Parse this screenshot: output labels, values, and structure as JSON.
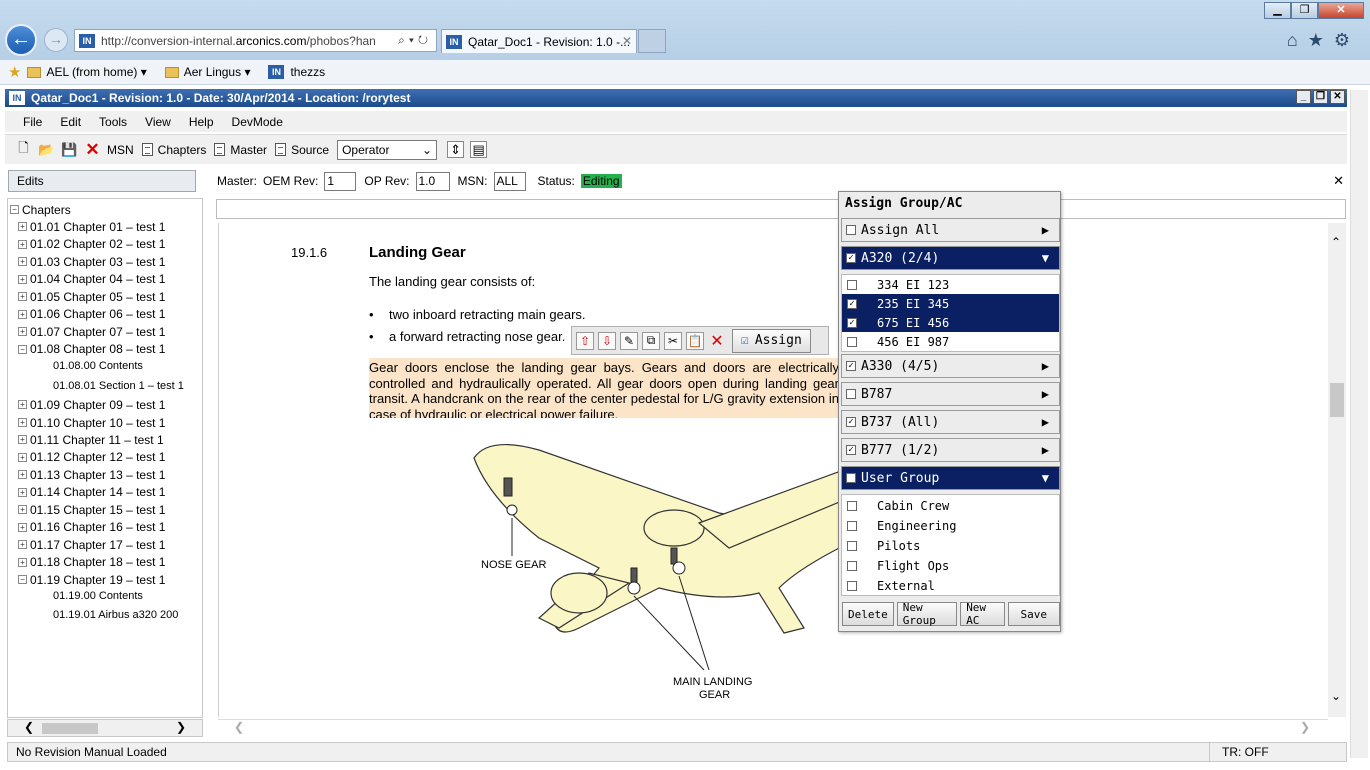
{
  "browser": {
    "url_prefix": "http://conversion-internal.",
    "url_domain": "arconics.com",
    "url_suffix": "/phobos?han",
    "tab_title": "Qatar_Doc1 - Revision: 1.0 -...",
    "favorites": [
      "AEL (from home) ▾",
      "Aer Lingus ▾",
      "thezzs"
    ]
  },
  "app": {
    "title": "Qatar_Doc1 - Revision: 1.0 - Date: 30/Apr/2014 - Location: /rorytest",
    "menu": [
      "File",
      "Edit",
      "Tools",
      "View",
      "Help",
      "DevMode"
    ],
    "toolbar": {
      "msn": "MSN",
      "chapters": "Chapters",
      "master": "Master",
      "source": "Source",
      "view_select": "Operator"
    },
    "edits_tab": "Edits",
    "master_bar": {
      "master_label": "Master:",
      "oem_rev_label": "OEM Rev:",
      "oem_rev_value": "1",
      "op_rev_label": "OP Rev:",
      "op_rev_value": "1.0",
      "msn_label": "MSN:",
      "msn_value": "ALL",
      "status_label": "Status:",
      "status_value": "Editing"
    },
    "status_bar": {
      "left": "No Revision Manual Loaded",
      "right": "TR: OFF"
    }
  },
  "tree": {
    "root": "Chapters",
    "items": [
      {
        "label": "01.01 Chapter 01 – test 1",
        "expanded": false
      },
      {
        "label": "01.02 Chapter 02 – test 1",
        "expanded": false
      },
      {
        "label": "01.03 Chapter 03 – test 1",
        "expanded": false
      },
      {
        "label": "01.04 Chapter 04 – test 1",
        "expanded": false
      },
      {
        "label": "01.05 Chapter 05 – test 1",
        "expanded": false
      },
      {
        "label": "01.06 Chapter 06 – test 1",
        "expanded": false
      },
      {
        "label": "01.07 Chapter 07 – test 1",
        "expanded": false
      },
      {
        "label": "01.08 Chapter 08 – test 1",
        "expanded": true
      },
      {
        "label": "01.08.00 Contents",
        "leaf": true
      },
      {
        "label": "01.08.01 Section 1 – test 1",
        "leaf": true
      },
      {
        "label": "01.09 Chapter 09 – test 1",
        "expanded": false
      },
      {
        "label": "01.10 Chapter 10 – test 1",
        "expanded": false
      },
      {
        "label": "01.11 Chapter 11 – test 1",
        "expanded": false
      },
      {
        "label": "01.12 Chapter 12 – test 1",
        "expanded": false
      },
      {
        "label": "01.13 Chapter 13 – test 1",
        "expanded": false
      },
      {
        "label": "01.14 Chapter 14 – test 1",
        "expanded": false
      },
      {
        "label": "01.15 Chapter 15 – test 1",
        "expanded": false
      },
      {
        "label": "01.16 Chapter 16 – test 1",
        "expanded": false
      },
      {
        "label": "01.17 Chapter 17 – test 1",
        "expanded": false
      },
      {
        "label": "01.18 Chapter 18 – test 1",
        "expanded": false
      },
      {
        "label": "01.19 Chapter 19 – test 1",
        "expanded": true
      },
      {
        "label": "01.19.00 Contents",
        "leaf": true
      },
      {
        "label": "01.19.01 Airbus a320 200",
        "leaf": true
      }
    ]
  },
  "document": {
    "section_number": "19.1.6",
    "section_title": "Landing Gear",
    "intro": "The landing gear consists of:",
    "bullets": [
      "two inboard retracting main gears.",
      "a forward retracting nose gear."
    ],
    "highlight_text": "Gear doors enclose the landing gear bays. Gears and doors are electrically controlled and hydraulically operated. All gear doors open during landing gear transit. A handcrank on the rear of the center pedestal for L/G gravity extension in case of hydraulic or electrical power failure.",
    "figure_labels": {
      "nose_gear": "NOSE GEAR",
      "main_gear_line1": "MAIN LANDING",
      "main_gear_line2": "GEAR"
    },
    "assign_button": "Assign"
  },
  "assign_panel": {
    "title": "Assign Group/AC",
    "assign_all": "Assign All",
    "groups": [
      {
        "label": "A320  (2/4)",
        "checked": true,
        "selected": true,
        "expanded": true,
        "items": [
          {
            "label": "334  EI 123",
            "checked": false,
            "selected": false
          },
          {
            "label": "235  EI 345",
            "checked": true,
            "selected": true
          },
          {
            "label": "675  EI 456",
            "checked": true,
            "selected": true
          },
          {
            "label": "456  EI 987",
            "checked": false,
            "selected": false
          }
        ]
      },
      {
        "label": "A330  (4/5)",
        "checked": true,
        "selected": false,
        "expanded": false
      },
      {
        "label": "B787",
        "checked": false,
        "selected": false,
        "expanded": false
      },
      {
        "label": "B737  (All)",
        "checked": true,
        "selected": false,
        "expanded": false
      },
      {
        "label": "B777  (1/2)",
        "checked": true,
        "selected": false,
        "expanded": false
      }
    ],
    "user_group": {
      "label": "User Group",
      "items": [
        "Cabin Crew",
        "Engineering",
        "Pilots",
        "Flight Ops",
        "External"
      ]
    },
    "buttons": [
      "Delete",
      "New Group",
      "New AC",
      "Save"
    ]
  }
}
